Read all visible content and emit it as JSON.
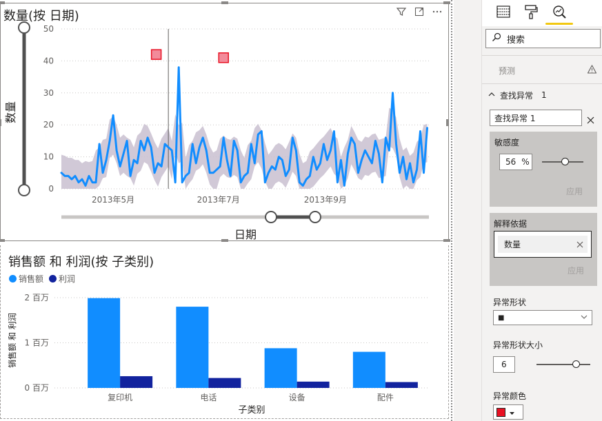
{
  "line_visual": {
    "title": "数量(按 日期)",
    "x_axis_title": "日期",
    "y_axis_title": "数量",
    "header_icons": [
      "filter-icon",
      "focus-mode-icon",
      "more-options-icon"
    ]
  },
  "bar_visual": {
    "title": "销售额 和 利润(按 子类别)",
    "x_axis_title": "子类别",
    "y_axis_title": "销售额 和 利润",
    "legend": [
      {
        "label": "销售额",
        "color": "#118dff"
      },
      {
        "label": "利润",
        "color": "#12239e"
      }
    ]
  },
  "pane": {
    "search_placeholder": "搜索",
    "forecast_label": "预测",
    "anomaly_section_label": "查找异常",
    "anomaly_count": "1",
    "anomaly_name": "查找异常 1",
    "sensitivity_label": "敏感度",
    "sensitivity_value": "56",
    "sensitivity_unit": "%",
    "sensitivity_fraction": 0.56,
    "apply_label": "应用",
    "explain_by_label": "解释依据",
    "explain_field": "数量",
    "shape_label": "异常形状",
    "shape_value": "■",
    "shape_size_label": "异常形状大小",
    "shape_size_value": "6",
    "shape_size_fraction": 0.6,
    "color_label": "异常颜色",
    "anomaly_color": "#e81123"
  },
  "chart_data": [
    {
      "type": "line",
      "title": "数量(按 日期)",
      "xlabel": "日期",
      "ylabel": "数量",
      "ylim": [
        0,
        50
      ],
      "yticks": [
        0,
        10,
        20,
        30,
        40,
        50
      ],
      "x_start": "2013-04-01",
      "x_end": "2013-10-31",
      "x_tick_labels": [
        {
          "label": "2013年5月",
          "date": "2013-05-01"
        },
        {
          "label": "2013年7月",
          "date": "2013-07-01"
        },
        {
          "label": "2013年9月",
          "date": "2013-09-01"
        }
      ],
      "series": [
        {
          "color": "#118dff",
          "x": [
            "2013-04-01",
            "2013-04-03",
            "2013-04-05",
            "2013-04-07",
            "2013-04-09",
            "2013-04-11",
            "2013-04-13",
            "2013-04-15",
            "2013-04-17",
            "2013-04-19",
            "2013-04-21",
            "2013-04-23",
            "2013-04-25",
            "2013-04-27",
            "2013-04-29",
            "2013-05-01",
            "2013-05-03",
            "2013-05-05",
            "2013-05-07",
            "2013-05-09",
            "2013-05-11",
            "2013-05-13",
            "2013-05-15",
            "2013-05-17",
            "2013-05-19",
            "2013-05-21",
            "2013-05-23",
            "2013-05-25",
            "2013-05-27",
            "2013-05-29",
            "2013-05-31",
            "2013-06-02",
            "2013-06-04",
            "2013-06-06",
            "2013-06-08",
            "2013-06-10",
            "2013-06-12",
            "2013-06-14",
            "2013-06-16",
            "2013-06-18",
            "2013-06-20",
            "2013-06-22",
            "2013-06-24",
            "2013-06-26",
            "2013-06-28",
            "2013-06-30",
            "2013-07-02",
            "2013-07-04",
            "2013-07-06",
            "2013-07-08",
            "2013-07-10",
            "2013-07-12",
            "2013-07-14",
            "2013-07-16",
            "2013-07-18",
            "2013-07-20",
            "2013-07-22",
            "2013-07-24",
            "2013-07-26",
            "2013-07-28",
            "2013-07-30",
            "2013-08-01",
            "2013-08-03",
            "2013-08-05",
            "2013-08-07",
            "2013-08-09",
            "2013-08-11",
            "2013-08-13",
            "2013-08-15",
            "2013-08-17",
            "2013-08-19",
            "2013-08-21",
            "2013-08-23",
            "2013-08-25",
            "2013-08-27",
            "2013-08-29",
            "2013-08-31",
            "2013-09-02",
            "2013-09-04",
            "2013-09-06",
            "2013-09-08",
            "2013-09-10",
            "2013-09-12",
            "2013-09-14",
            "2013-09-16",
            "2013-09-18",
            "2013-09-20",
            "2013-09-22",
            "2013-09-24",
            "2013-09-26",
            "2013-09-28",
            "2013-09-30",
            "2013-10-02",
            "2013-10-04",
            "2013-10-06",
            "2013-10-08",
            "2013-10-10",
            "2013-10-12",
            "2013-10-14",
            "2013-10-16",
            "2013-10-18",
            "2013-10-20",
            "2013-10-22",
            "2013-10-24",
            "2013-10-26",
            "2013-10-28",
            "2013-10-30"
          ],
          "values": [
            5,
            4,
            4,
            3,
            4,
            2,
            3,
            1,
            4,
            2,
            2,
            14,
            5,
            9,
            15,
            23,
            12,
            7,
            11,
            15,
            4,
            9,
            8,
            15,
            12,
            16,
            13,
            5,
            8,
            7,
            14,
            13,
            12,
            2,
            38,
            2,
            4,
            5,
            14,
            8,
            13,
            16,
            12,
            5,
            5,
            6,
            7,
            16,
            9,
            4,
            15,
            12,
            2,
            4,
            5,
            14,
            8,
            17,
            18,
            2,
            5,
            7,
            6,
            10,
            9,
            4,
            6,
            16,
            12,
            2,
            1,
            3,
            4,
            10,
            6,
            8,
            14,
            9,
            12,
            18,
            2,
            9,
            1,
            11,
            16,
            14,
            5,
            9,
            12,
            10,
            8,
            15,
            11,
            2,
            16,
            12,
            30,
            14,
            5,
            10,
            3,
            8,
            2,
            6,
            18,
            5,
            19
          ]
        }
      ],
      "anomalies": [
        {
          "date": "2013-05-26",
          "value": 42
        },
        {
          "date": "2013-07-04",
          "value": 41
        }
      ],
      "cursor_date": "2013-06-02"
    },
    {
      "type": "bar",
      "title": "销售额 和 利润(按 子类别)",
      "xlabel": "子类别",
      "ylabel": "销售额 和 利润",
      "categories": [
        "复印机",
        "电话",
        "设备",
        "配件"
      ],
      "ylim": [
        0,
        2000000
      ],
      "yticks": [
        0,
        1000000,
        2000000
      ],
      "ytick_labels": [
        "0 百万",
        "1 百万",
        "2 百万"
      ],
      "legend_position": "top-left",
      "series": [
        {
          "name": "销售额",
          "color": "#118dff",
          "values": [
            1990000,
            1800000,
            880000,
            800000
          ]
        },
        {
          "name": "利润",
          "color": "#12239e",
          "values": [
            260000,
            220000,
            140000,
            130000
          ]
        }
      ]
    }
  ]
}
